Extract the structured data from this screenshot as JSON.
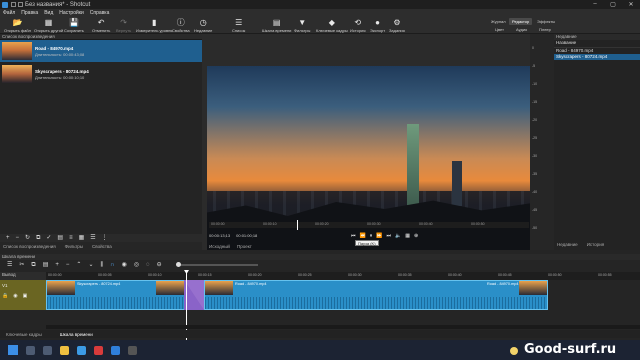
{
  "window": {
    "title": "Без названия* - Shotcut"
  },
  "menu": [
    "Файл",
    "Правка",
    "Вид",
    "Настройки",
    "Справка"
  ],
  "toolbar": [
    {
      "icon": "open-file-icon",
      "label": "Открыть файл",
      "enabled": true
    },
    {
      "icon": "open-other-icon",
      "label": "Открыть другой",
      "enabled": true
    },
    {
      "icon": "save-icon",
      "label": "Сохранить",
      "enabled": true
    },
    {
      "icon": "undo-icon",
      "label": "Отменить",
      "enabled": true
    },
    {
      "icon": "redo-icon",
      "label": "Вернуть",
      "enabled": false
    },
    {
      "icon": "peak-meter-icon",
      "label": "Измеритель уровня",
      "enabled": true
    },
    {
      "icon": "properties-icon",
      "label": "Свойства",
      "enabled": true
    },
    {
      "icon": "recent-icon",
      "label": "Недавние",
      "enabled": true
    },
    {
      "icon": "playlist-icon",
      "label": "Список",
      "enabled": true
    },
    {
      "icon": "timeline-icon",
      "label": "Шкала времени",
      "enabled": true
    },
    {
      "icon": "filters-icon",
      "label": "Фильтры",
      "enabled": true
    },
    {
      "icon": "keyframes-icon",
      "label": "Ключевые кадры",
      "enabled": true
    },
    {
      "icon": "history-icon",
      "label": "История",
      "enabled": true
    },
    {
      "icon": "export-icon",
      "label": "Экспорт",
      "enabled": true
    },
    {
      "icon": "jobs-icon",
      "label": "Задания",
      "enabled": true
    }
  ],
  "layouts": {
    "row1": [
      {
        "label": "Журнал",
        "active": false
      },
      {
        "label": "Редактор",
        "active": true
      },
      {
        "label": "Эффекты",
        "active": false
      }
    ],
    "row2": [
      {
        "label": "Цвет",
        "active": false
      },
      {
        "label": "Аудио",
        "active": false
      },
      {
        "label": "Плеер",
        "active": false
      }
    ]
  },
  "playlist": {
    "title": "Список воспроизведения",
    "items": [
      {
        "name": "Road - 84970.mp4",
        "duration": "Длительность: 00:00:43;08",
        "selected": true
      },
      {
        "name": "Skyscrapers - 80724.mp4",
        "duration": "Длительность: 00:00:10;10",
        "selected": false
      }
    ],
    "tabs": [
      "Список воспроизведения",
      "Фильтры",
      "Свойства"
    ]
  },
  "viewer": {
    "ruler": [
      "00:00:00",
      "00:00:10",
      "00:00:20",
      "00:00:30",
      "00:00:40",
      "00:00:50"
    ],
    "timecode_current": "00:00:13;13",
    "timecode_total": "00:01:00;18",
    "tooltip": "Пауза (K)",
    "tabs": [
      "Исходный",
      "Проект"
    ]
  },
  "meter": [
    "0",
    "-5",
    "-10",
    "-15",
    "-20",
    "-25",
    "-30",
    "-35",
    "-40",
    "-45",
    "-50"
  ],
  "recent": {
    "title": "Недавние",
    "header": "Название",
    "items": [
      {
        "name": "Road - 84970.mp4",
        "selected": false
      },
      {
        "name": "Skyscrapers - 80724.mp4",
        "selected": true
      }
    ],
    "tabs": [
      "Недавние",
      "История"
    ]
  },
  "timeline": {
    "title": "Шкала времени",
    "output_label": "Вывод",
    "track_name": "V1",
    "ruler": [
      "00:00:00",
      "00:00:05",
      "00:00:10",
      "00:00:15",
      "00:00:20",
      "00:00:25",
      "00:00:30",
      "00:00:35",
      "00:00:40",
      "00:00:45",
      "00:00:50",
      "00:00:55"
    ],
    "clips": [
      {
        "label": "Skyscrapers - 80724.mp4"
      },
      {
        "label": "Road - 84970.mp4"
      }
    ],
    "tail_label": "Road - 84970.mp4",
    "tabs": [
      "Ключевые кадры",
      "Шкала времени"
    ]
  },
  "taskbar": {
    "watermark": "Good-surf.ru"
  }
}
